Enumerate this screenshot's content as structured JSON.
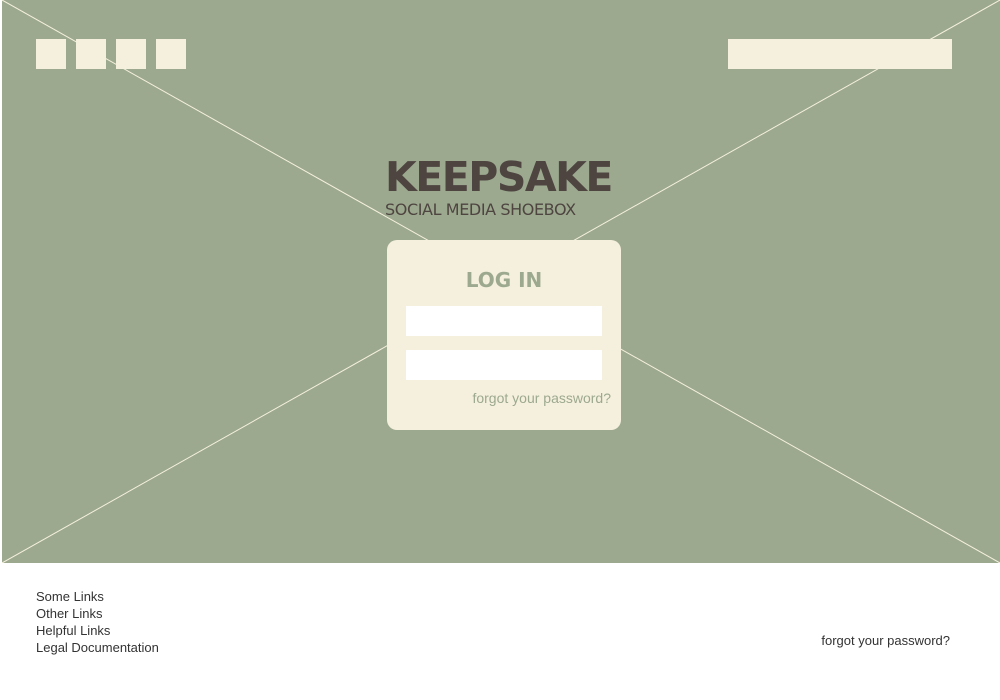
{
  "colors": {
    "hero_background": "#9ca98f",
    "cream": "#f5f0dd",
    "brand_text": "#4e4541",
    "accent_text": "#9ca98f",
    "footer_text": "#333333"
  },
  "nav": {
    "items": [
      "",
      "",
      "",
      ""
    ]
  },
  "search": {
    "placeholder": ""
  },
  "brand": {
    "title": "KEEPSAKE",
    "subtitle": "SOCIAL MEDIA SHOEBOX"
  },
  "login": {
    "title": "LOG IN",
    "username_placeholder": "",
    "password_placeholder": "",
    "forgot_label": "forgot your password?"
  },
  "footer": {
    "links": [
      "Some Links",
      "Other Links",
      "Helpful Links",
      "Legal Documentation"
    ],
    "forgot_label": "forgot your password?"
  }
}
